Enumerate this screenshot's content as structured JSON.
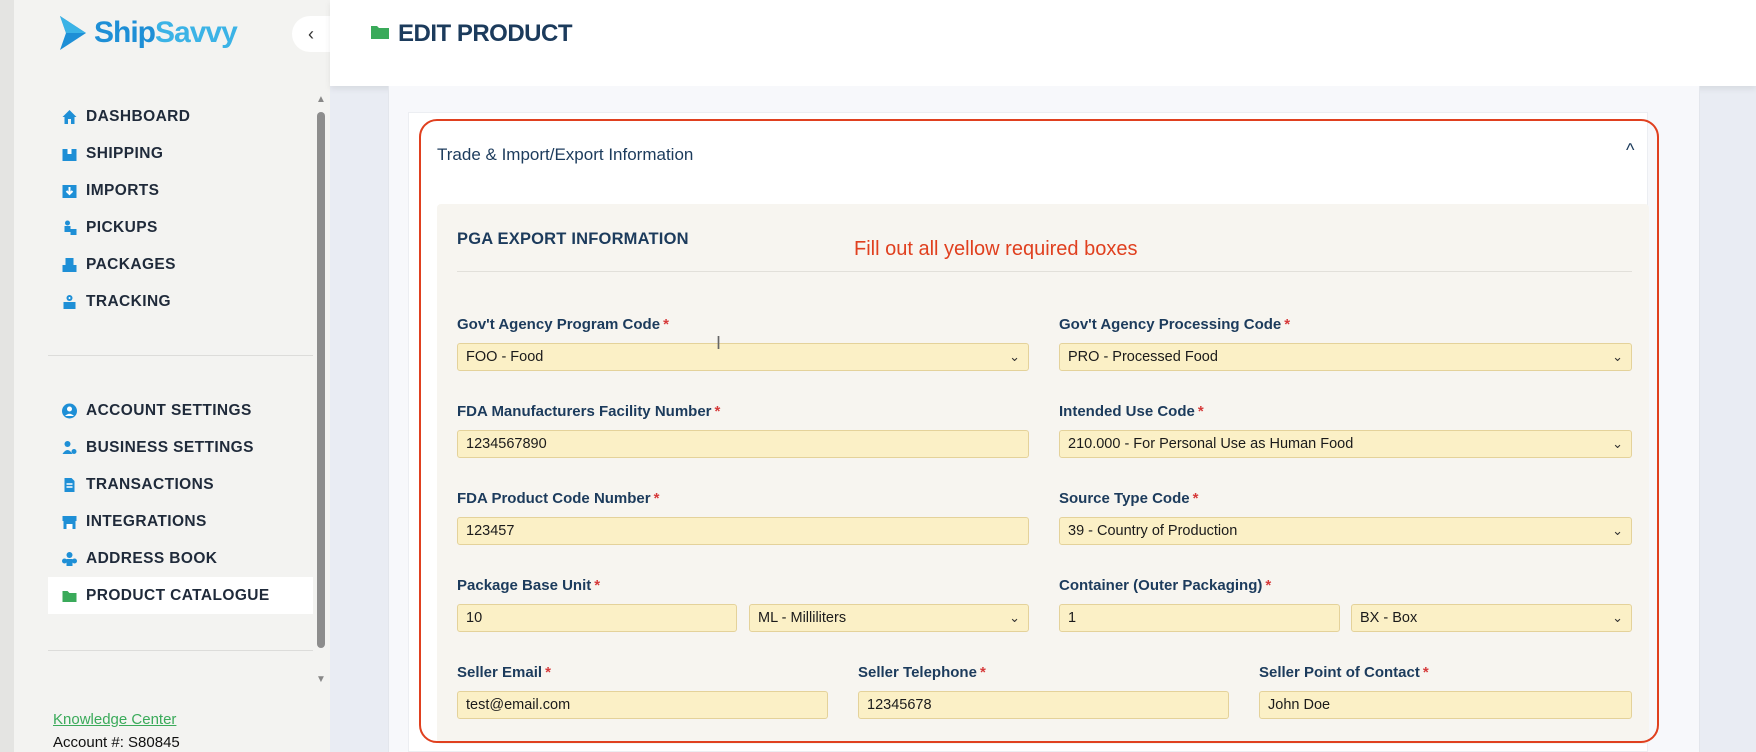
{
  "brand": {
    "name_a": "Ship",
    "name_b": "Savvy",
    "accent": "#1e8fd6"
  },
  "sidebar": {
    "collapse_icon": "chevron-left-icon",
    "nav_primary": [
      {
        "label": "DASHBOARD",
        "icon": "home-icon"
      },
      {
        "label": "SHIPPING",
        "icon": "box-icon"
      },
      {
        "label": "IMPORTS",
        "icon": "import-icon"
      },
      {
        "label": "PICKUPS",
        "icon": "pickup-icon"
      },
      {
        "label": "PACKAGES",
        "icon": "packages-icon"
      },
      {
        "label": "TRACKING",
        "icon": "tracking-icon"
      }
    ],
    "nav_secondary": [
      {
        "label": "ACCOUNT SETTINGS",
        "icon": "user-circle-icon"
      },
      {
        "label": "BUSINESS SETTINGS",
        "icon": "business-icon"
      },
      {
        "label": "TRANSACTIONS",
        "icon": "document-icon"
      },
      {
        "label": "INTEGRATIONS",
        "icon": "store-icon"
      },
      {
        "label": "ADDRESS BOOK",
        "icon": "address-book-icon"
      },
      {
        "label": "PRODUCT CATALOGUE",
        "icon": "folder-icon",
        "active": true
      }
    ],
    "knowledge_center": "Knowledge Center",
    "account": "Account #: S80845"
  },
  "header": {
    "title": "EDIT PRODUCT"
  },
  "section": {
    "title": "Trade & Import/Export Information"
  },
  "card": {
    "title": "PGA EXPORT INFORMATION"
  },
  "annotation": "Fill out all yellow required boxes",
  "fields": {
    "gov_agency_program_code": {
      "label": "Gov't Agency Program Code",
      "value": "FOO - Food"
    },
    "gov_agency_processing_code": {
      "label": "Gov't Agency Processing Code",
      "value": "PRO - Processed Food"
    },
    "fda_manufacturers_facility_number": {
      "label": "FDA Manufacturers Facility Number",
      "value": "1234567890"
    },
    "intended_use_code": {
      "label": "Intended Use Code",
      "value": "210.000 - For Personal Use as Human Food"
    },
    "fda_product_code_number": {
      "label": "FDA Product Code Number",
      "value": "123457"
    },
    "source_type_code": {
      "label": "Source Type Code",
      "value": "39 - Country of Production"
    },
    "package_base_unit": {
      "label": "Package Base Unit",
      "value": "10",
      "unit": "ML - Milliliters"
    },
    "container_outer_packaging": {
      "label": "Container (Outer Packaging)",
      "value": "1",
      "unit": "BX - Box"
    },
    "seller_email": {
      "label": "Seller Email",
      "value": "test@email.com"
    },
    "seller_telephone": {
      "label": "Seller Telephone",
      "value": "12345678"
    },
    "seller_point_of_contact": {
      "label": "Seller Point of Contact",
      "value": "John Doe"
    }
  },
  "required_marker": "*",
  "colors": {
    "required_field_bg": "#fbf0c6",
    "highlight": "#e0401f",
    "heading": "#1c3b5c"
  }
}
